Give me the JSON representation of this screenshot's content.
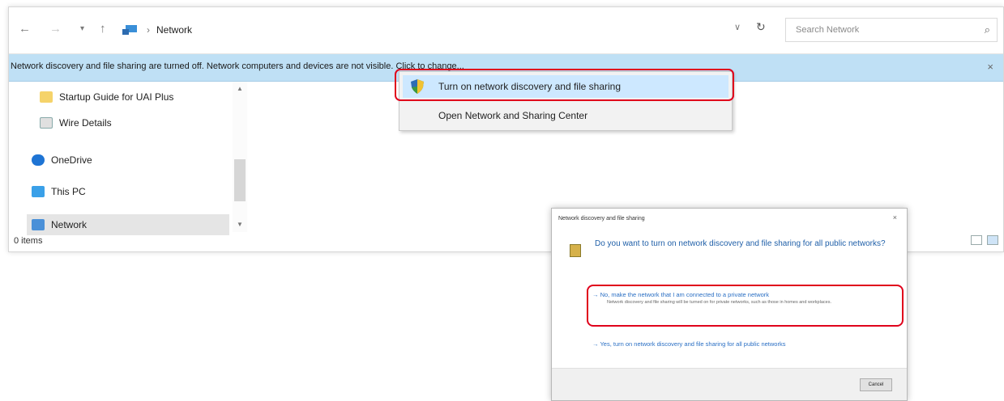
{
  "explorer": {
    "nav": {
      "back": "←",
      "forward": "→",
      "recent": "▾",
      "up": "↑"
    },
    "address": {
      "separator": "›",
      "location": "Network",
      "dropdown": "∨",
      "refresh": "↻"
    },
    "search": {
      "placeholder": "Search Network",
      "icon": "⌕"
    },
    "infobar": {
      "message": "Network discovery and file sharing are turned off. Network computers and devices are not visible. Click to change...",
      "close": "×"
    },
    "navpane": {
      "items": [
        {
          "label": "Startup Guide for UAI Plus",
          "icon": "document-icon"
        },
        {
          "label": "Wire Details",
          "icon": "file-icon"
        },
        {
          "label": "OneDrive",
          "icon": "cloud-icon"
        },
        {
          "label": "This PC",
          "icon": "computer-icon"
        },
        {
          "label": "Network",
          "icon": "network-icon"
        }
      ]
    },
    "status": {
      "count": "0 items"
    }
  },
  "context_menu": {
    "items": [
      {
        "label": "Turn on network discovery and file sharing",
        "icon": "shield-icon"
      },
      {
        "label": "Open Network and Sharing Center"
      }
    ]
  },
  "dialog": {
    "title": "Network discovery and file sharing",
    "close": "×",
    "question": "Do you want to turn on network discovery and file sharing for all public networks?",
    "option1": {
      "arrow": "→",
      "label": "No, make the network that I am connected to a private network",
      "sub": "Network discovery and file sharing will be turned on for private networks, such as those in homes and workplaces."
    },
    "option2": {
      "arrow": "→",
      "label": "Yes, turn on network discovery and file sharing for all public networks"
    },
    "cancel": "Cancel"
  },
  "colors": {
    "highlight": "#e0001b",
    "infobar": "#bfe0f5",
    "link": "#2a6fc4"
  }
}
